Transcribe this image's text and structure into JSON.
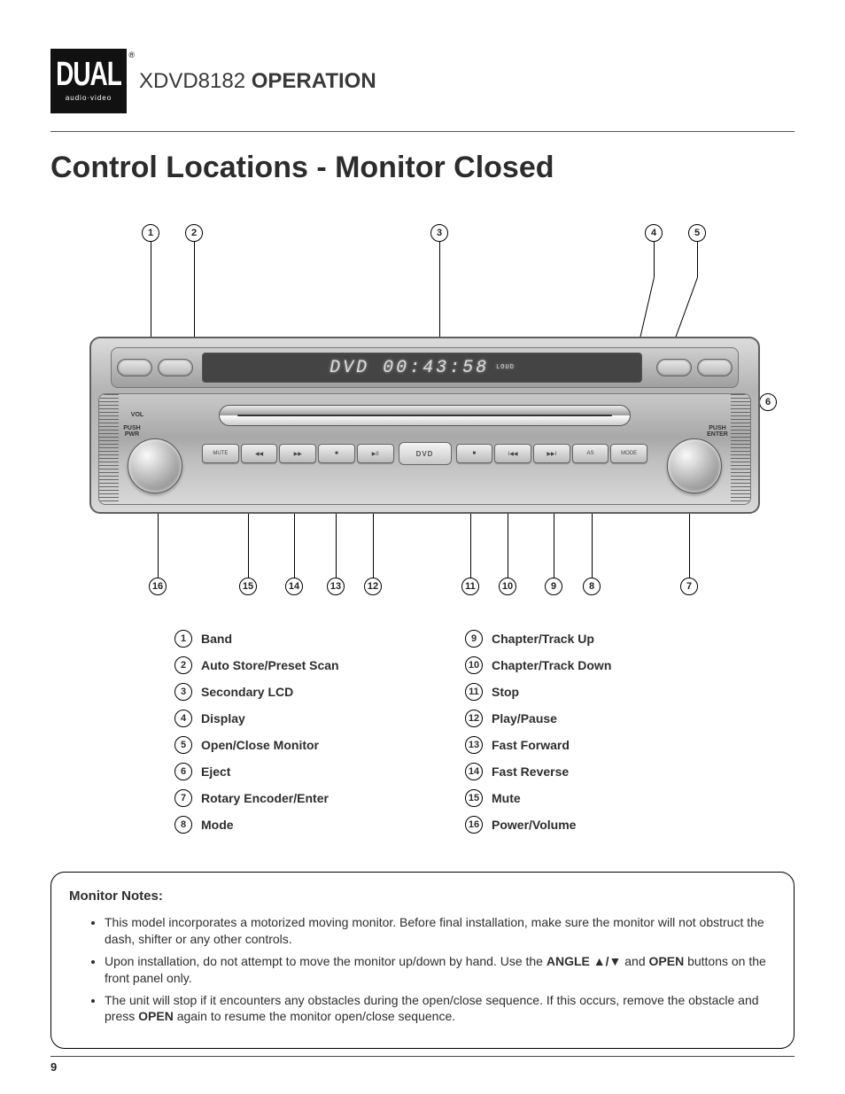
{
  "header": {
    "logo_top": "DUAL",
    "logo_sub": "audio·video",
    "model": "XDVD8182",
    "section": "OPERATION"
  },
  "title": "Control Locations - Monitor Closed",
  "lcd": {
    "text": "DVD 00:43:58",
    "indicator": "LOUD"
  },
  "device": {
    "label_push_pwr": "PUSH\nPWR",
    "label_vol": "VOL",
    "label_push_enter": "PUSH\nENTER",
    "center_label": "DVD",
    "left_buttons": [
      "MUTE",
      "◀◀",
      "▶▶",
      "■",
      "▶II"
    ],
    "right_buttons": [
      "■",
      "I◀◀",
      "▶▶I",
      "AS",
      "MODE"
    ]
  },
  "callouts_top": [
    "1",
    "2",
    "3",
    "4",
    "5"
  ],
  "callout_side": "6",
  "callouts_bot": [
    "16",
    "15",
    "14",
    "13",
    "12",
    "11",
    "10",
    "9",
    "8",
    "7"
  ],
  "legend": [
    {
      "n": "1",
      "label": "Band"
    },
    {
      "n": "2",
      "label": "Auto Store/Preset Scan"
    },
    {
      "n": "3",
      "label": "Secondary LCD"
    },
    {
      "n": "4",
      "label": "Display"
    },
    {
      "n": "5",
      "label": "Open/Close Monitor"
    },
    {
      "n": "6",
      "label": "Eject"
    },
    {
      "n": "7",
      "label": "Rotary Encoder/Enter"
    },
    {
      "n": "8",
      "label": "Mode"
    },
    {
      "n": "9",
      "label": "Chapter/Track Up"
    },
    {
      "n": "10",
      "label": "Chapter/Track Down"
    },
    {
      "n": "11",
      "label": "Stop"
    },
    {
      "n": "12",
      "label": "Play/Pause"
    },
    {
      "n": "13",
      "label": "Fast Forward"
    },
    {
      "n": "14",
      "label": "Fast Reverse"
    },
    {
      "n": "15",
      "label": "Mute"
    },
    {
      "n": "16",
      "label": "Power/Volume"
    }
  ],
  "notes": {
    "title": "Monitor Notes:",
    "items": [
      {
        "pre": "This model incorporates a motorized moving monitor. Before final installation, make sure the monitor will not obstruct the dash, shifter or any other controls."
      },
      {
        "pre": "Upon installation, do not attempt to move the monitor up/down by hand. Use the ",
        "b1": "ANGLE ▲/▼",
        "mid": " and ",
        "b2": "OPEN",
        "post": " buttons on the front panel only."
      },
      {
        "pre": "The unit will stop if it encounters any obstacles during the open/close sequence. If this occurs, remove the obstacle and press ",
        "b1": "OPEN",
        "post": " again to resume the monitor open/close sequence."
      }
    ]
  },
  "page_number": "9"
}
